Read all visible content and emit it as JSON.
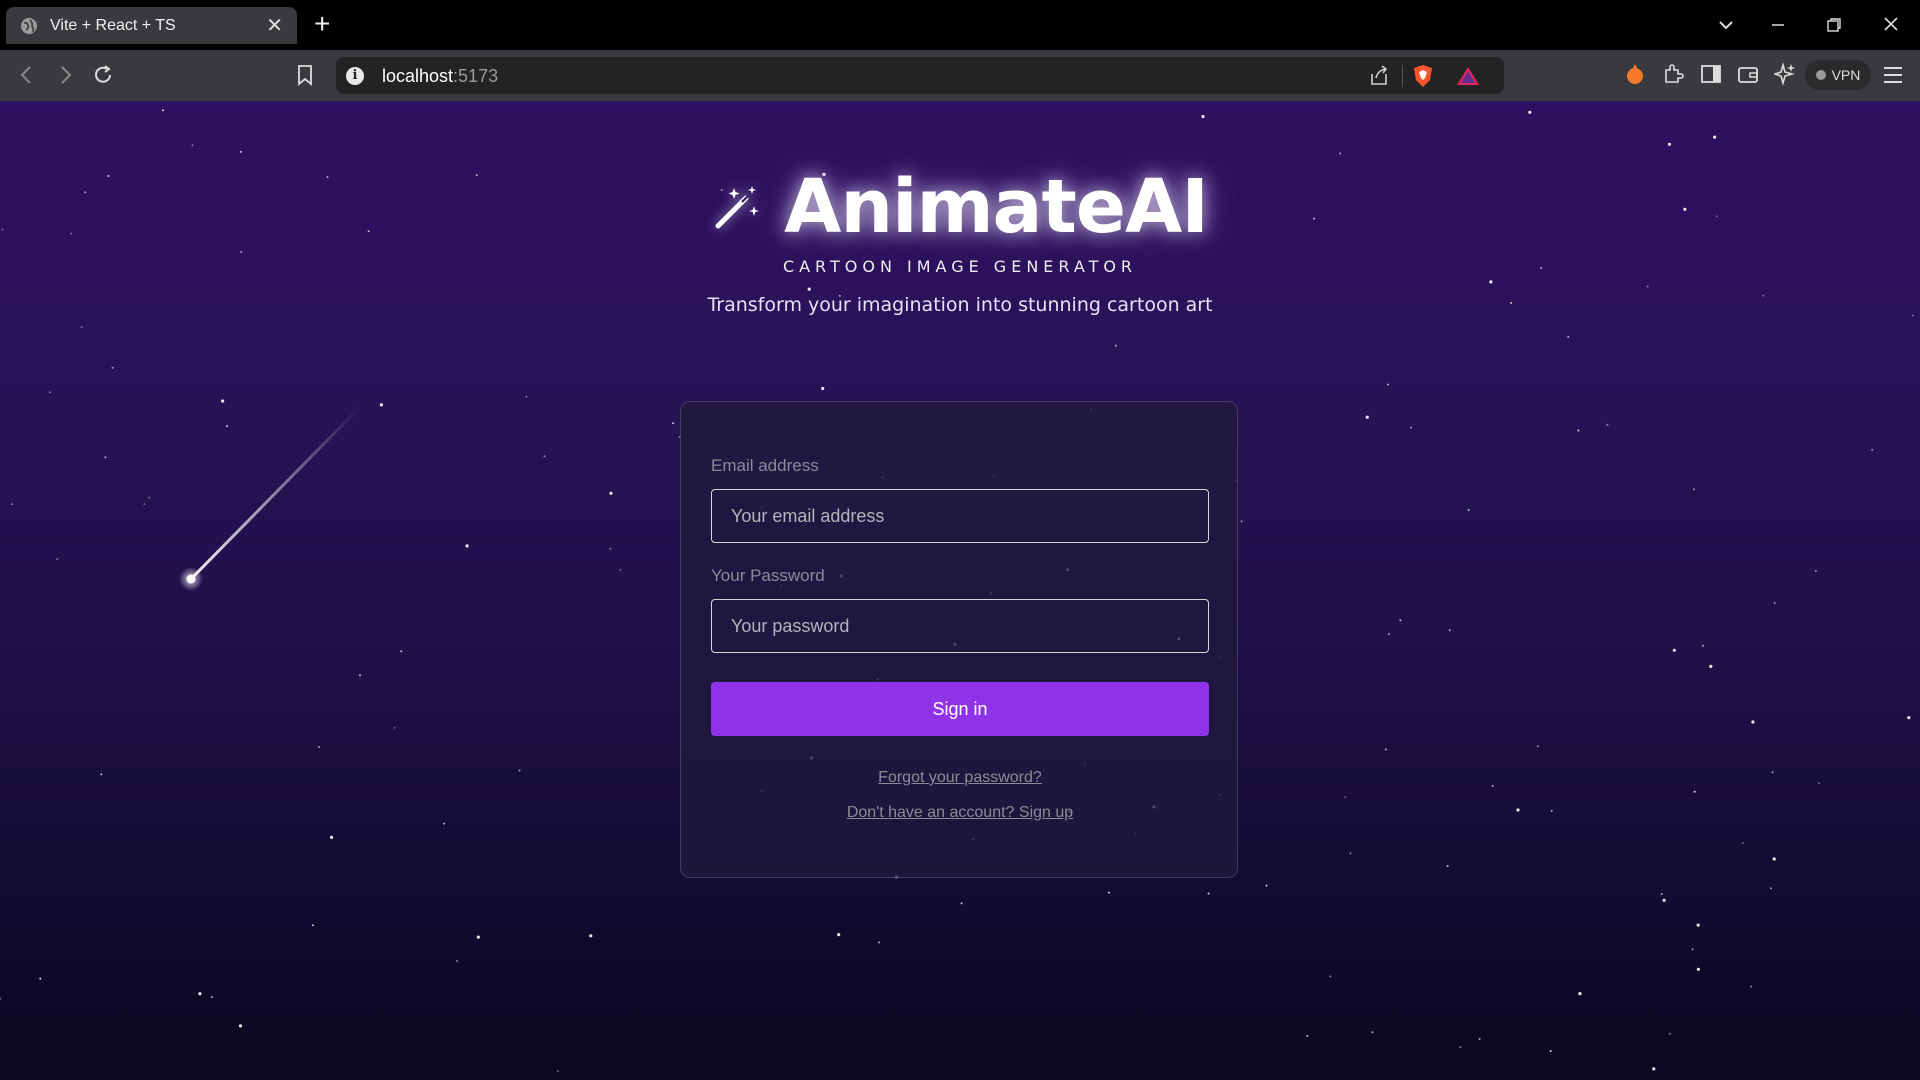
{
  "browser": {
    "tab_title": "Vite + React + TS",
    "url_host": "localhost",
    "url_port": ":5173",
    "vpn_label": "VPN",
    "icons": [
      "globe-icon",
      "close-icon",
      "plus-icon",
      "chevron-down-icon",
      "minimize-icon",
      "restore-icon",
      "close-window-icon",
      "back-icon",
      "forward-icon",
      "reload-icon",
      "bookmark-icon",
      "info-icon",
      "share-icon",
      "brave-shield-icon",
      "brave-rewards-icon",
      "leo-icon",
      "extensions-icon",
      "sidebar-icon",
      "wallet-icon",
      "ai-sparkle-icon",
      "menu-icon"
    ]
  },
  "hero": {
    "title": "AnimateAI",
    "tagline": "CARTOON IMAGE GENERATOR",
    "subtitle": "Transform your imagination into stunning cartoon art",
    "icon": "magic-wand-icon"
  },
  "form": {
    "email_label": "Email address",
    "email_placeholder": "Your email address",
    "email_value": "",
    "password_label": "Your Password",
    "password_placeholder": "Your password",
    "password_value": "",
    "signin_label": "Sign in",
    "forgot_link": "Forgot your password?",
    "signup_link": "Don't have an account? Sign up"
  },
  "colors": {
    "accent": "#9033e8",
    "background_top": "#2e0f61",
    "background_bottom": "#0a0720"
  }
}
